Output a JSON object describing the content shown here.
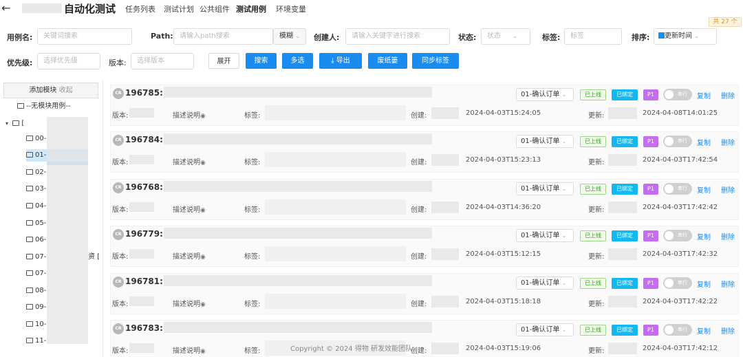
{
  "header": {
    "back_icon": "arrow-left-icon",
    "app_title": "自动化测试",
    "nav": [
      "任务列表",
      "测试计划",
      "公共组件",
      "测试用例",
      "环境变量"
    ],
    "active_nav": "测试用例",
    "count_badge": "共 27 个"
  },
  "filters": {
    "case_name_label": "用例名:",
    "case_name_placeholder": "关键词搜索",
    "path_label": "Path:",
    "path_placeholder": "请输入path搜索",
    "match_mode": "模糊",
    "creator_label": "创建人:",
    "creator_placeholder": "请输入关键字进行搜索",
    "status_label": "状态:",
    "status_placeholder": "状态",
    "tag_label": "标签:",
    "tag_placeholder": "标签",
    "sort_label": "排序:",
    "sort_value": "更新时间",
    "priority_label": "优先级:",
    "priority_placeholder": "选择优先级",
    "version_label": "版本:",
    "version_placeholder": "选择版本"
  },
  "toolbar": {
    "expand": "展开",
    "search": "搜索",
    "multi_select": "多选",
    "export": "导出",
    "recycle_bin": "废纸篓",
    "sync_tags": "同步标签"
  },
  "sidebar": {
    "add_module": "添加模块",
    "collapse": "收起",
    "items": [
      "--无模块用例--",
      "[",
      "00-",
      "01-",
      "02-",
      "03-",
      "04-",
      "05-",
      "06-",
      "07-",
      "07-",
      "08-",
      "09-",
      "10-",
      "11-"
    ],
    "item7_suffix": "资 ["
  },
  "cases": [
    {
      "id": "196785:",
      "status": "01-确认订单",
      "online": "已上线",
      "bound": "已绑定",
      "priority": "P1",
      "serial": "串行",
      "copy": "复制",
      "delete": "删除",
      "version_label": "版本:",
      "desc": "描述说明",
      "tag_label": "标签:",
      "created_label": "创建:",
      "created": "2024-04-03T15:24:05",
      "updated_label": "更新:",
      "updated": "2024-04-08T14:01:25"
    },
    {
      "id": "196784:",
      "status": "01-确认订单",
      "online": "已上线",
      "bound": "已绑定",
      "priority": "P1",
      "serial": "串行",
      "copy": "复制",
      "delete": "删除",
      "version_label": "版本:",
      "desc": "描述说明",
      "tag_label": "标签:",
      "created_label": "创建:",
      "created": "2024-04-03T15:23:13",
      "updated_label": "更新:",
      "updated": "2024-04-03T17:42:54"
    },
    {
      "id": "196768:",
      "status": "01-确认订单",
      "online": "已上线",
      "bound": "已绑定",
      "priority": "P1",
      "serial": "串行",
      "copy": "复制",
      "delete": "删除",
      "version_label": "版本:",
      "desc": "描述说明",
      "tag_label": "标签:",
      "created_label": "创建:",
      "created": "2024-04-03T14:36:20",
      "updated_label": "更新:",
      "updated": "2024-04-03T17:42:42"
    },
    {
      "id": "196779:",
      "status": "01-确认订单",
      "online": "已上线",
      "bound": "已绑定",
      "priority": "P1",
      "serial": "串行",
      "copy": "复制",
      "delete": "删除",
      "version_label": "版本:",
      "desc": "描述说明",
      "tag_label": "标签:",
      "created_label": "创建:",
      "created": "2024-04-03T15:12:15",
      "updated_label": "更新:",
      "updated": "2024-04-03T17:42:32"
    },
    {
      "id": "196781:",
      "status": "01-确认订单",
      "online": "已上线",
      "bound": "已绑定",
      "priority": "P1",
      "serial": "串行",
      "copy": "复制",
      "delete": "删除",
      "version_label": "版本:",
      "desc": "描述说明",
      "tag_label": "标签:",
      "created_label": "创建:",
      "created": "2024-04-03T15:18:18",
      "updated_label": "更新:",
      "updated": "2024-04-03T17:42:22"
    },
    {
      "id": "196783:",
      "status": "01-确认订单",
      "online": "已上线",
      "bound": "已绑定",
      "priority": "P1",
      "serial": "串行",
      "copy": "复制",
      "delete": "删除",
      "version_label": "版本:",
      "desc": "描述说明",
      "tag_label": "标签:",
      "created_label": "创建:",
      "created": "2024-04-03T15:19:06",
      "updated_label": "更新:",
      "updated": "2024-04-03T17:42:12"
    }
  ],
  "footer": "Copyright © 2024 得物 研发效能团队",
  "colors": {
    "primary": "#1a8cf0",
    "online_green": "#2f9e1e",
    "bound_blue": "#13b8f0",
    "priority_purple": "#c66cf0",
    "warning": "#e8940f"
  }
}
